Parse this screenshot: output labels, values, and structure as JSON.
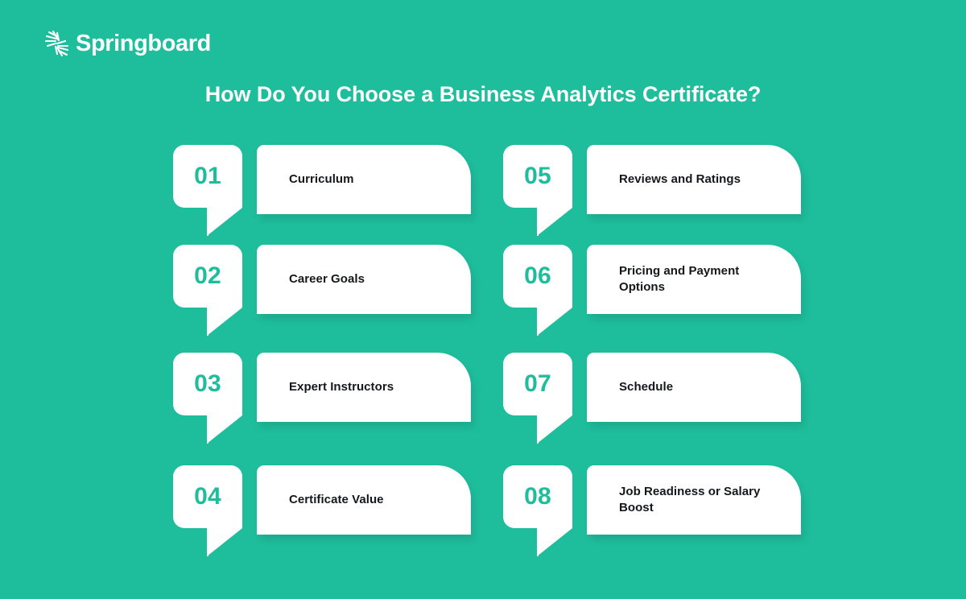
{
  "theme": {
    "background": "#1ebe9d",
    "card_background": "#ffffff",
    "number_color": "#1ebe9d",
    "label_color": "#15171a",
    "heading_color": "#ffffff"
  },
  "brand": {
    "name": "Springboard",
    "mark": "springboard-starburst-icon"
  },
  "heading": {
    "title": "How Do You Choose a Business Analytics Certificate?"
  },
  "items": [
    {
      "number": "01",
      "label": "Curriculum"
    },
    {
      "number": "02",
      "label": "Career Goals"
    },
    {
      "number": "03",
      "label": "Expert Instructors"
    },
    {
      "number": "04",
      "label": "Certificate Value"
    },
    {
      "number": "05",
      "label": "Reviews and Ratings"
    },
    {
      "number": "06",
      "label": "Pricing and Payment Options"
    },
    {
      "number": "07",
      "label": "Schedule"
    },
    {
      "number": "08",
      "label": "Job Readiness or Salary Boost"
    }
  ]
}
